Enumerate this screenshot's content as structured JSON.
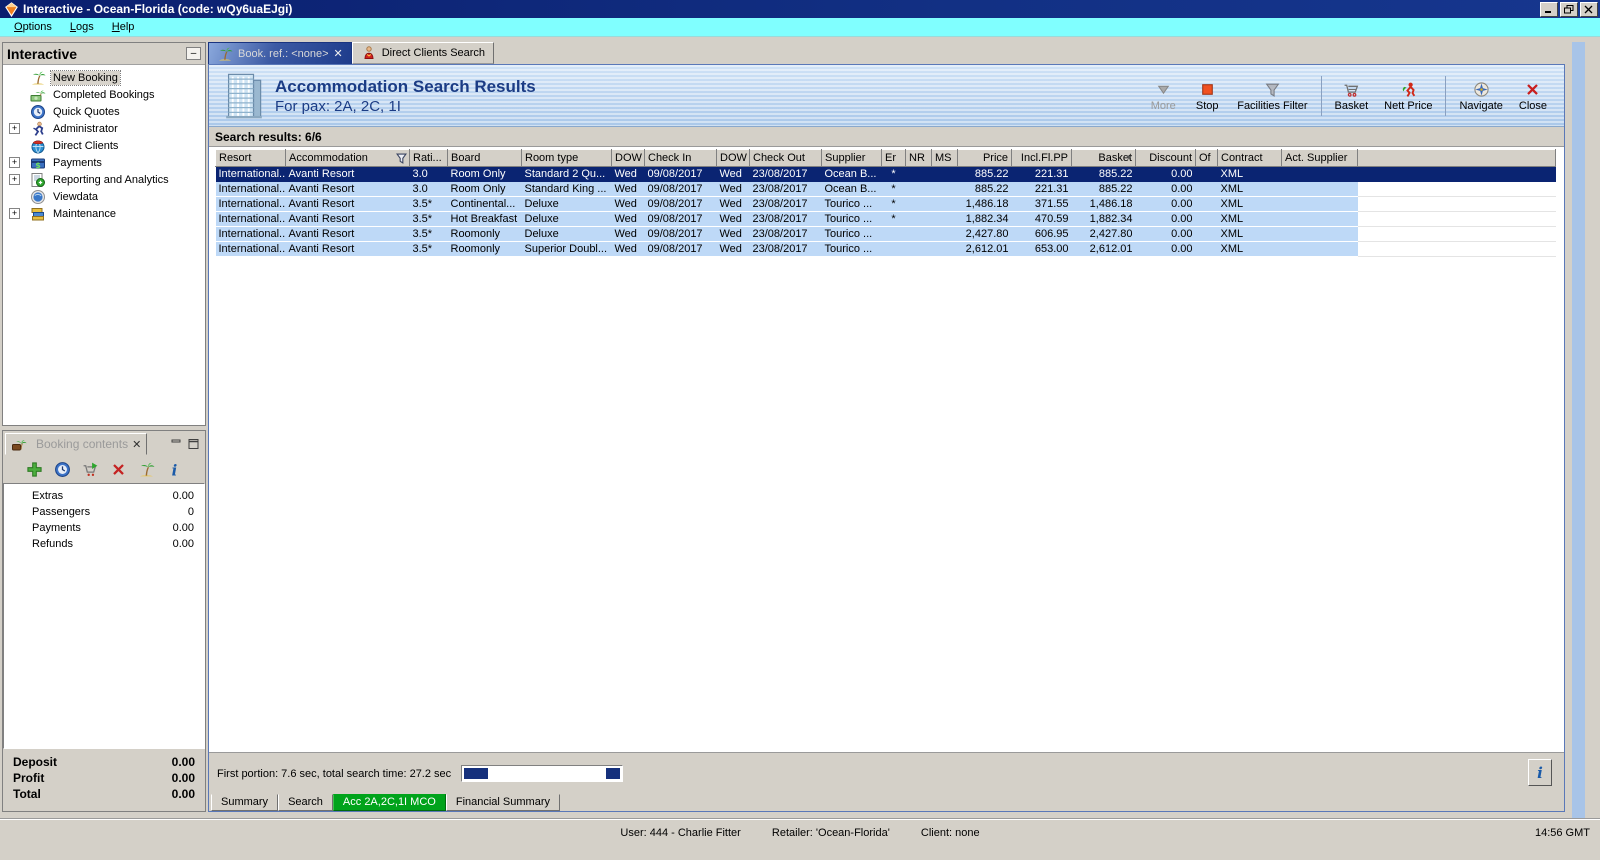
{
  "window": {
    "title": "Interactive - Ocean-Florida (code: wQy6uaEJgi)",
    "menu": {
      "options": "Options",
      "logs": "Logs",
      "help": "Help"
    },
    "statusbar": {
      "user": "User: 444 - Charlie Fitter",
      "retailer": "Retailer: 'Ocean-Florida'",
      "client": "Client: none",
      "time": "14:56 GMT"
    }
  },
  "sidebar": {
    "title": "Interactive",
    "items": [
      {
        "label": "New Booking",
        "icon": "palm-tree-icon",
        "expandable": false,
        "selected": true
      },
      {
        "label": "Completed Bookings",
        "icon": "completed-bookings-icon",
        "expandable": false,
        "selected": false
      },
      {
        "label": "Quick Quotes",
        "icon": "quick-quotes-icon",
        "expandable": false,
        "selected": false
      },
      {
        "label": "Administrator",
        "icon": "administrator-icon",
        "expandable": true,
        "selected": false
      },
      {
        "label": "Direct Clients",
        "icon": "direct-clients-icon",
        "expandable": false,
        "selected": false
      },
      {
        "label": "Payments",
        "icon": "payments-icon",
        "expandable": true,
        "selected": false
      },
      {
        "label": "Reporting and Analytics",
        "icon": "reporting-icon",
        "expandable": true,
        "selected": false
      },
      {
        "label": "Viewdata",
        "icon": "viewdata-icon",
        "expandable": false,
        "selected": false
      },
      {
        "label": "Maintenance",
        "icon": "maintenance-icon",
        "expandable": true,
        "selected": false
      }
    ]
  },
  "booking_contents": {
    "title": "Booking contents",
    "rows": [
      {
        "label": "Extras",
        "value": "0.00"
      },
      {
        "label": "Passengers",
        "value": "0"
      },
      {
        "label": "Payments",
        "value": "0.00"
      },
      {
        "label": "Refunds",
        "value": "0.00"
      }
    ],
    "totals": [
      {
        "label": "Deposit",
        "value": "0.00"
      },
      {
        "label": "Profit",
        "value": "0.00"
      },
      {
        "label": "Total",
        "value": "0.00"
      }
    ]
  },
  "main": {
    "tabs": [
      {
        "label": "Book. ref.: <none>",
        "active": true
      },
      {
        "label": "Direct Clients Search",
        "active": false
      }
    ],
    "header": {
      "title": "Accommodation Search Results",
      "subtitle": "For pax: 2A, 2C, 1I"
    },
    "toolbar": {
      "more": "More",
      "stop": "Stop",
      "facilities_filter": "Facilities Filter",
      "basket": "Basket",
      "nett_price": "Nett Price",
      "navigate": "Navigate",
      "close": "Close"
    },
    "results_label": "Search results: 6/6",
    "table": {
      "columns": [
        "Resort",
        "Accommodation",
        "Rati...",
        "Board",
        "Room type",
        "DOW",
        "Check In",
        "DOW",
        "Check Out",
        "Supplier",
        "Er",
        "NR",
        "MS",
        "Price",
        "Incl.Fl.PP",
        "Basket",
        "Discount",
        "Of",
        "Contract",
        "Act. Supplier"
      ],
      "selected_row": 0,
      "rows": [
        [
          "International...",
          "Avanti Resort",
          "3.0",
          "Room Only",
          "Standard 2 Qu...",
          "Wed",
          "09/08/2017",
          "Wed",
          "23/08/2017",
          "Ocean B...",
          "*",
          "",
          "",
          "885.22",
          "221.31",
          "885.22",
          "0.00",
          "",
          "XML",
          ""
        ],
        [
          "International...",
          "Avanti Resort",
          "3.0",
          "Room Only",
          "Standard King ...",
          "Wed",
          "09/08/2017",
          "Wed",
          "23/08/2017",
          "Ocean B...",
          "*",
          "",
          "",
          "885.22",
          "221.31",
          "885.22",
          "0.00",
          "",
          "XML",
          ""
        ],
        [
          "International...",
          "Avanti Resort",
          "3.5*",
          "Continental...",
          "Deluxe",
          "Wed",
          "09/08/2017",
          "Wed",
          "23/08/2017",
          "Tourico ...",
          "*",
          "",
          "",
          "1,486.18",
          "371.55",
          "1,486.18",
          "0.00",
          "",
          "XML",
          ""
        ],
        [
          "International...",
          "Avanti Resort",
          "3.5*",
          "Hot Breakfast",
          "Deluxe",
          "Wed",
          "09/08/2017",
          "Wed",
          "23/08/2017",
          "Tourico ...",
          "*",
          "",
          "",
          "1,882.34",
          "470.59",
          "1,882.34",
          "0.00",
          "",
          "XML",
          ""
        ],
        [
          "International...",
          "Avanti Resort",
          "3.5*",
          "Roomonly",
          "Deluxe",
          "Wed",
          "09/08/2017",
          "Wed",
          "23/08/2017",
          "Tourico ...",
          "",
          "",
          "",
          "2,427.80",
          "606.95",
          "2,427.80",
          "0.00",
          "",
          "XML",
          ""
        ],
        [
          "International...",
          "Avanti Resort",
          "3.5*",
          "Roomonly",
          "Superior Doubl...",
          "Wed",
          "09/08/2017",
          "Wed",
          "23/08/2017",
          "Tourico ...",
          "",
          "",
          "",
          "2,612.01",
          "653.00",
          "2,612.01",
          "0.00",
          "",
          "XML",
          ""
        ]
      ]
    },
    "search_status": "First portion: 7.6 sec, total search time: 27.2 sec",
    "bottom_tabs": [
      {
        "label": "Summary",
        "highlight": false
      },
      {
        "label": "Search",
        "highlight": false
      },
      {
        "label": "Acc 2A,2C,1I MCO",
        "highlight": true
      },
      {
        "label": "Financial Summary",
        "highlight": false
      }
    ],
    "info_button": "i"
  },
  "colors": {
    "titlebar": "#123084",
    "menubar": "#80ffff",
    "selected_row": "#0a2472",
    "row_blue": "#bed9f7",
    "green_tab": "#00a31b",
    "accent_text": "#1b3c85"
  }
}
